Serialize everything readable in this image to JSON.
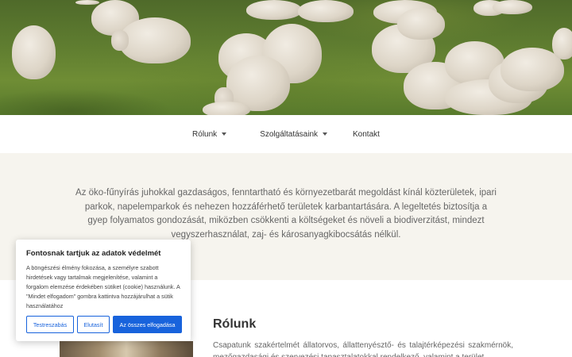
{
  "hero": {
    "image": "sheep-grazing-photo"
  },
  "nav": {
    "items": [
      {
        "label": "Rólunk",
        "dropdown": true
      },
      {
        "label": "Szolgáltatásaink",
        "dropdown": true
      },
      {
        "label": "Kontakt",
        "dropdown": false
      }
    ]
  },
  "intro": {
    "text": "Az öko-fűnyírás juhokkal gazdaságos, fenntartható és környezetbarát megoldást kínál közterületek, ipari parkok, napelemparkok és nehezen hozzáférhető területek karbantartására. A legeltetés biztosítja a gyep folyamatos gondozását, miközben csökkenti a költségeket és növeli a biodiverzitást, mindezt vegyszerhasználat, zaj- és károsanyagkibocsátás nélkül."
  },
  "about": {
    "title": "Rólunk",
    "text": "Csapatunk szakértelmét állatorvos, állattenyésztő- és talajtérképezési szakmérnök, mezőgazdasági és szervezési tapasztalatokkal rendelkező, valamint a terület"
  },
  "cookie": {
    "title": "Fontosnak tartjuk az adatok védelmét",
    "text": "A böngészési élmény fokozása, a személyre szabott hirdetések vagy tartalmak megjelenítése, valamint a forgalom elemzése érdekében sütiket (cookie) használunk. A \"Mindet elfogadom\" gombra kattintva hozzájárulhat a sütik használatához",
    "buttons": {
      "customize": "Testreszabás",
      "reject": "Elutasít",
      "accept_all": "Az összes elfogadása"
    }
  },
  "colors": {
    "accent": "#1863dc",
    "intro_bg": "#f6f4ee"
  }
}
